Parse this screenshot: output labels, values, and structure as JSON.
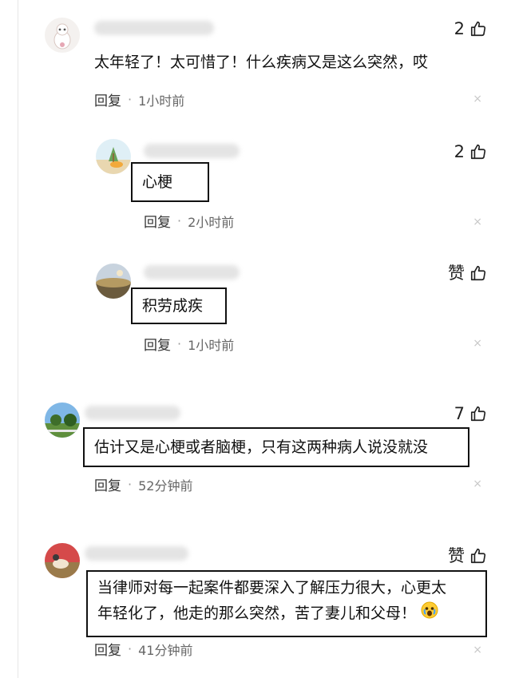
{
  "comments": [
    {
      "likes": "2",
      "text": "太年轻了！太可惜了！什么疾病又是这么突然，哎",
      "reply": "回复",
      "dot": "·",
      "time": "1小时前",
      "close": "×",
      "replies": [
        {
          "name_fragment": "热",
          "likes": "2",
          "text": "心梗",
          "reply": "回复",
          "dot": "·",
          "time": "2小时前",
          "close": "×"
        },
        {
          "likes": "赞",
          "text": "积劳成疾",
          "reply": "回复",
          "dot": "·",
          "time": "1小时前",
          "close": "×"
        }
      ]
    },
    {
      "likes": "7",
      "text": "估计又是心梗或者脑梗，只有这两种病人说没就没",
      "reply": "回复",
      "dot": "·",
      "time": "52分钟前",
      "close": "×"
    },
    {
      "likes": "赞",
      "text_line1": "当律师对每一起案件都要深入了解压力很大，心更太",
      "text_line2": "年轻化了，他走的那么突然，苦了妻儿和父母！",
      "emoji": "crying-face-emoji",
      "reply": "回复",
      "dot": "·",
      "time": "41分钟前",
      "close": "×"
    }
  ],
  "icons": {
    "like": "thumbs-up-icon",
    "close": "close-icon"
  },
  "colors": {
    "text": "#111111",
    "meta": "#666666",
    "border": "#111111",
    "muted": "#c8c8c8"
  }
}
